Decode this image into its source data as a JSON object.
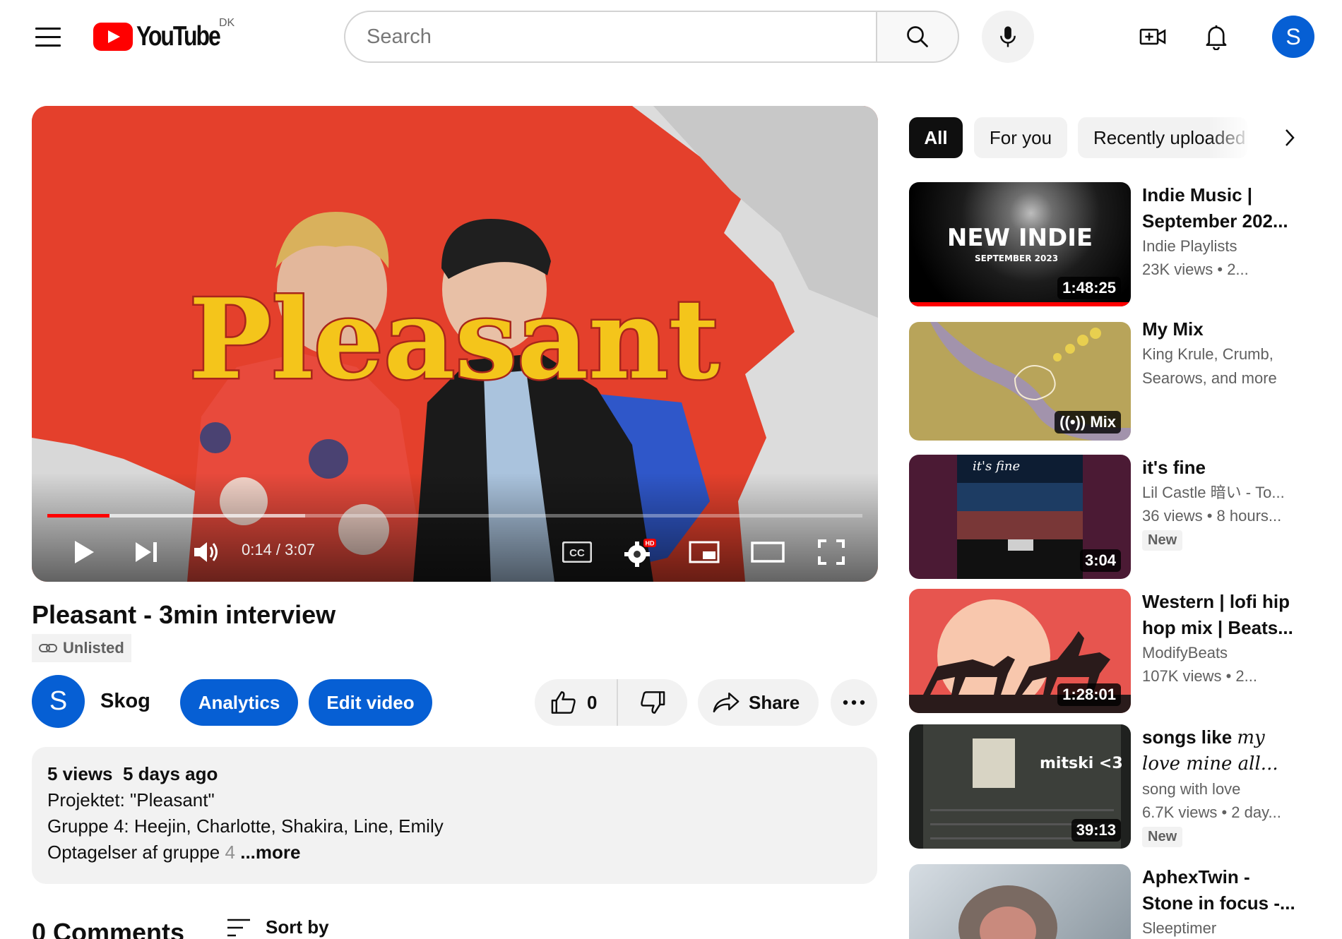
{
  "header": {
    "logo_text": "YouTube",
    "country_code": "DK",
    "search_placeholder": "Search",
    "avatar_letter": "S"
  },
  "player": {
    "thumbnail_text": "Pleasant",
    "current_time": "0:14",
    "duration": "3:07",
    "time_display": "0:14 / 3:07",
    "played_fraction": 0.076,
    "buffered_fraction": 0.316,
    "hd_badge": "HD"
  },
  "video": {
    "title": "Pleasant - 3min interview",
    "visibility": "Unlisted",
    "channel_name": "Skog",
    "channel_avatar_letter": "S",
    "analytics_label": "Analytics",
    "edit_label": "Edit video",
    "like_count": "0",
    "share_label": "Share",
    "more_label": "···"
  },
  "description": {
    "views": "5 views",
    "age": "5 days ago",
    "line1": "Projektet: \"Pleasant\"",
    "line2": "Gruppe 4: Heejin, Charlotte, Shakira, Line, Emily",
    "line3": "Optagelser af gruppe",
    "line3_fade": "4",
    "more_link": "...more"
  },
  "comments": {
    "title": "0 Comments",
    "sort_label": "Sort by"
  },
  "chips": {
    "all": "All",
    "for_you": "For you",
    "recently_uploaded": "Recently uploaded"
  },
  "recommendations": [
    {
      "title_line1": "Indie Music |",
      "title_line2": "September 202...",
      "channel": "Indie Playlists",
      "meta": "23K views  • 2...",
      "duration": "1:48:25",
      "thumb_text1": "NEW INDIE",
      "thumb_text2": "SEPTEMBER 2023"
    },
    {
      "title_line1": "My Mix",
      "channel": "King Krule, Crumb,",
      "channel_line2": "Searows, and more",
      "badge": "Mix"
    },
    {
      "title_line1": "it's fine",
      "channel": "Lil Castle 暗い - To...",
      "meta": "36 views  • 8 hours...",
      "new_badge": "New",
      "duration": "3:04"
    },
    {
      "title_line1": "Western | lofi hip",
      "title_line2": "hop mix | Beats...",
      "channel": "ModifyBeats",
      "meta": "107K views  • 2...",
      "duration": "1:28:01"
    },
    {
      "title_line1": "songs like",
      "title_italic1": "my",
      "title_italic2": "love mine all...",
      "channel": "song with love",
      "meta": "6.7K views  • 2 day...",
      "new_badge": "New",
      "duration": "39:13",
      "thumb_text": "mitski <3"
    },
    {
      "title_line1": "AphexTwin -",
      "title_line2": "Stone in focus -...",
      "channel": "Sleeptimer"
    }
  ],
  "colors": {
    "brand_red": "#ff0000",
    "primary_blue": "#065fd4",
    "chip_bg": "#f2f2f2",
    "text_secondary": "#606060"
  }
}
